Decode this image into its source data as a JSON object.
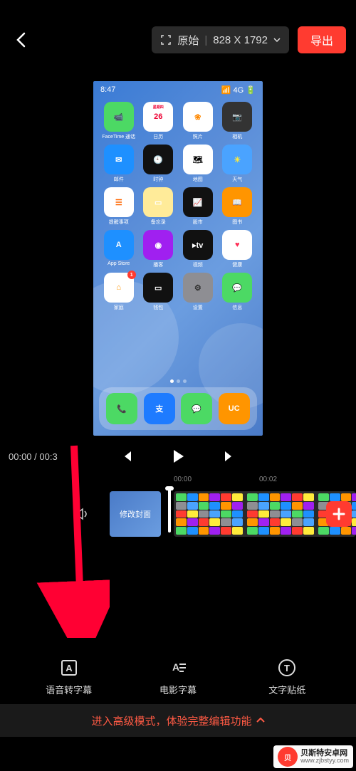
{
  "topbar": {
    "original_label": "原始",
    "dimensions": "828 X 1792",
    "export_label": "导出"
  },
  "phone": {
    "time": "8:47",
    "signal": "4G",
    "apps": [
      {
        "label": "FaceTime 通话",
        "bg": "#4cd964",
        "glyph": "📹"
      },
      {
        "label": "日历",
        "bg": "#ffffff",
        "glyph": "26",
        "sub": "星期四",
        "color": "#e03"
      },
      {
        "label": "照片",
        "bg": "#ffffff",
        "glyph": "❀",
        "color": "#f80"
      },
      {
        "label": "相机",
        "bg": "#333333",
        "glyph": "📷"
      },
      {
        "label": "邮件",
        "bg": "#1e90ff",
        "glyph": "✉",
        "color": "#fff"
      },
      {
        "label": "时钟",
        "bg": "#111111",
        "glyph": "🕙"
      },
      {
        "label": "地图",
        "bg": "#ffffff",
        "glyph": "🗺"
      },
      {
        "label": "天气",
        "bg": "#4aa3ff",
        "glyph": "☀",
        "color": "#ffeb3b"
      },
      {
        "label": "提醒事项",
        "bg": "#ffffff",
        "glyph": "☰",
        "color": "#f60"
      },
      {
        "label": "备忘录",
        "bg": "#ffeb99",
        "glyph": "▭",
        "color": "#fff"
      },
      {
        "label": "股市",
        "bg": "#111111",
        "glyph": "📈"
      },
      {
        "label": "图书",
        "bg": "#ff9500",
        "glyph": "📖",
        "color": "#fff"
      },
      {
        "label": "App Store",
        "bg": "#1e90ff",
        "glyph": "A",
        "color": "#fff"
      },
      {
        "label": "播客",
        "bg": "#a020f0",
        "glyph": "◉",
        "color": "#fff"
      },
      {
        "label": "视频",
        "bg": "#111111",
        "glyph": "▸tv",
        "color": "#fff"
      },
      {
        "label": "健康",
        "bg": "#ffffff",
        "glyph": "♥",
        "color": "#ff2d55"
      },
      {
        "label": "家庭",
        "bg": "#ffffff",
        "glyph": "⌂",
        "color": "#ff9500",
        "badge": "1"
      },
      {
        "label": "钱包",
        "bg": "#111111",
        "glyph": "▭",
        "color": "#fff"
      },
      {
        "label": "设置",
        "bg": "#8e8e93",
        "glyph": "⚙",
        "color": "#333"
      },
      {
        "label": "信息",
        "bg": "#4cd964",
        "glyph": "💬",
        "color": "#fff"
      }
    ],
    "dock": [
      {
        "bg": "#4cd964",
        "glyph": "📞"
      },
      {
        "bg": "#1e7bff",
        "glyph": "支",
        "color": "#fff"
      },
      {
        "bg": "#4cd964",
        "glyph": "💬"
      },
      {
        "bg": "#ff9500",
        "glyph": "UC",
        "color": "#fff"
      }
    ]
  },
  "controls": {
    "time_current": "00:00",
    "time_total": "00:3"
  },
  "timeline": {
    "ticks": [
      "00:00",
      "00:02"
    ],
    "thumb_label": "修改封面"
  },
  "bottom": {
    "tabs": [
      {
        "label": "语音转字幕"
      },
      {
        "label": "电影字幕"
      },
      {
        "label": "文字贴纸"
      }
    ]
  },
  "adv_mode": {
    "text": "进入高级模式，体验完整编辑功能"
  },
  "watermark": {
    "title": "贝斯特安卓网",
    "url": "www.zjbstyy.com"
  },
  "colors": {
    "accent": "#ff3b30"
  }
}
